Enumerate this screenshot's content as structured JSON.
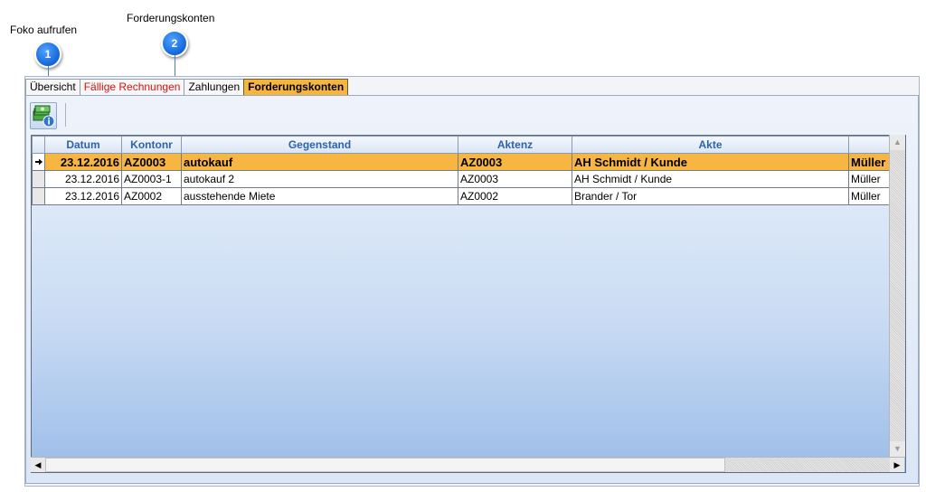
{
  "callouts": [
    {
      "number": "1",
      "label": "Foko aufrufen"
    },
    {
      "number": "2",
      "label": "Forderungskonten"
    }
  ],
  "tabs": [
    {
      "label": "Übersicht",
      "state": "normal"
    },
    {
      "label": "Fällige Rechnungen",
      "state": "red"
    },
    {
      "label": "Zahlungen",
      "state": "normal"
    },
    {
      "label": "Forderungskonten",
      "state": "active"
    }
  ],
  "toolbar": {
    "foko_icon": "money-info-icon"
  },
  "grid": {
    "columns": [
      "Datum",
      "Kontonr",
      "Gegenstand",
      "Aktenz",
      "Akte",
      ""
    ],
    "rows": [
      {
        "datum": "23.12.2016",
        "kontonr": "AZ0003",
        "gegenstand": "autokauf",
        "aktenz": "AZ0003",
        "akte": "AH Schmidt / Kunde",
        "extra": "Müller",
        "selected": true
      },
      {
        "datum": "23.12.2016",
        "kontonr": "AZ0003-1",
        "gegenstand": "autokauf 2",
        "aktenz": "AZ0003",
        "akte": "AH Schmidt / Kunde",
        "extra": "Müller",
        "selected": false
      },
      {
        "datum": "23.12.2016",
        "kontonr": "AZ0002",
        "gegenstand": "ausstehende Miete",
        "aktenz": "AZ0002",
        "akte": "Brander / Tor",
        "extra": "Müller",
        "selected": false
      }
    ]
  },
  "colors": {
    "selected_row": "#f7b641",
    "header_text": "#2c63ad",
    "red_tab": "#d21414",
    "badge": "#1466d8"
  }
}
